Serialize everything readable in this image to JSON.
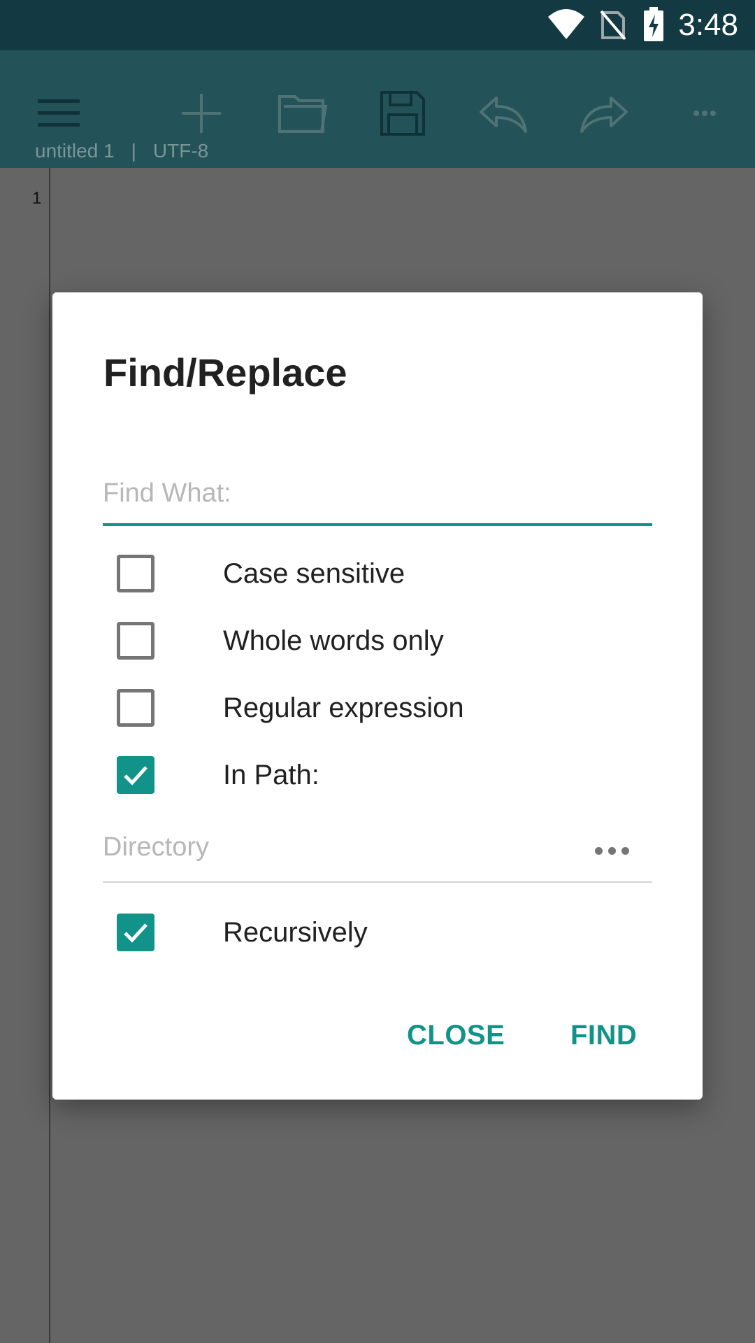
{
  "status_bar": {
    "time": "3:48"
  },
  "toolbar": {
    "file_name": "untitled 1",
    "separator": "|",
    "encoding": "UTF-8"
  },
  "editor": {
    "line_numbers": [
      "1"
    ]
  },
  "dialog": {
    "title": "Find/Replace",
    "find_placeholder": "Find What:",
    "options": [
      {
        "label": "Case sensitive",
        "checked": false
      },
      {
        "label": "Whole words only",
        "checked": false
      },
      {
        "label": "Regular expression",
        "checked": false
      },
      {
        "label": "In Path:",
        "checked": true
      }
    ],
    "directory_placeholder": "Directory",
    "recursive": {
      "label": "Recursively",
      "checked": true
    },
    "close_label": "CLOSE",
    "find_label": "FIND"
  },
  "colors": {
    "accent": "#129389",
    "toolbar": "#235258",
    "status_bar": "#133a42"
  }
}
